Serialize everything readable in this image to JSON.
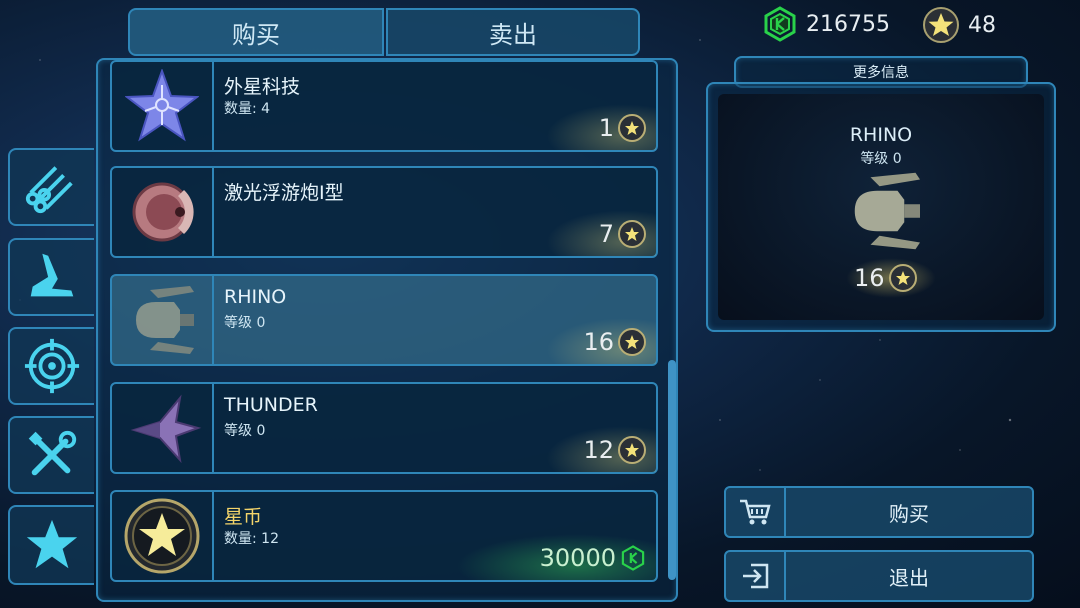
{
  "tabs": {
    "buy": "购买",
    "sell": "卖出"
  },
  "currency": {
    "gems": "216755",
    "stars": "48"
  },
  "items": [
    {
      "name": "外星科技",
      "sub": "数量: 4",
      "price": "1",
      "currency": "star"
    },
    {
      "name": "激光浮游炮I型",
      "sub": "",
      "price": "7",
      "currency": "star"
    },
    {
      "name": "RHINO",
      "sub": "等级 0",
      "price": "16",
      "currency": "star"
    },
    {
      "name": "THUNDER",
      "sub": "等级 0",
      "price": "12",
      "currency": "star"
    },
    {
      "name": "星币",
      "sub": "数量: 12",
      "price": "30000",
      "currency": "gem"
    }
  ],
  "info": {
    "header": "更多信息",
    "name": "RHINO",
    "level": "等级 0",
    "price": "16"
  },
  "actions": {
    "buy": "购买",
    "exit": "退出"
  },
  "colors": {
    "accent": "#2f86b8",
    "highlight_name": "#f3d46a",
    "gem": "#29d24a",
    "star": "#f4e27a"
  },
  "categories": [
    "pipes-icon",
    "claw-icon",
    "target-icon",
    "tools-icon",
    "star-icon"
  ]
}
